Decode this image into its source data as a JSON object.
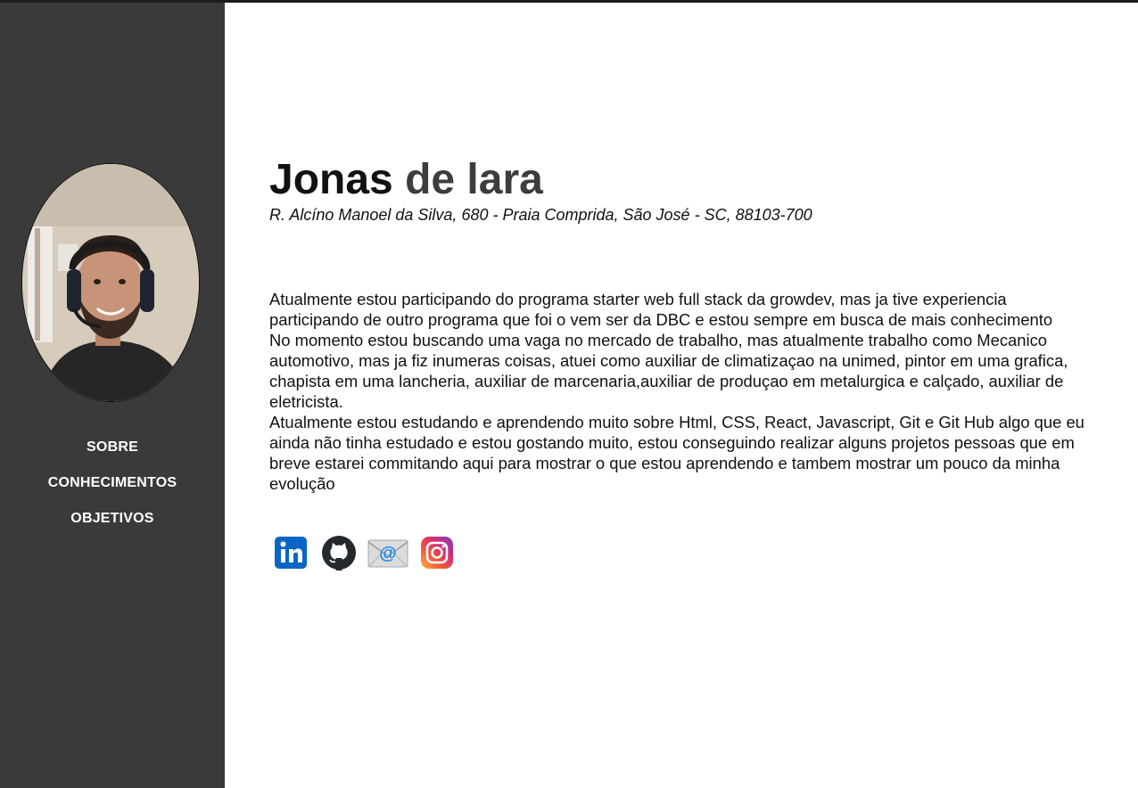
{
  "profile": {
    "first_name": "Jonas",
    "last_name": "de lara",
    "address": "R. Alcíno Manoel da Silva, 680 - Praia Comprida, São José - SC, 88103-700",
    "photo": "profile-photo"
  },
  "nav": {
    "items": [
      {
        "label": "SOBRE"
      },
      {
        "label": "CONHECIMENTOS"
      },
      {
        "label": "OBJETIVOS"
      }
    ]
  },
  "bio": {
    "paragraphs": [
      "Atualmente estou participando do programa starter web full stack da growdev, mas ja tive experiencia participando de outro programa que foi o vem ser da DBC e estou sempre em busca de mais conhecimento",
      "No momento estou buscando uma vaga no mercado de trabalho, mas atualmente trabalho como Mecanico automotivo, mas ja fiz inumeras coisas, atuei como auxiliar de climatizaçao na unimed, pintor em uma grafica, chapista em uma lancheria, auxiliar de marcenaria,auxiliar de produçao em metalurgica e calçado, auxiliar de eletricista.",
      "Atualmente estou estudando e aprendendo muito sobre Html, CSS, React, Javascript, Git e Git Hub algo que eu ainda não tinha estudado e estou gostando muito, estou conseguindo realizar alguns projetos pessoas que em breve estarei commitando aqui para mostrar o que estou aprendendo e tambem mostrar um pouco da minha evolução"
    ]
  },
  "social": {
    "links": [
      {
        "icon": "linkedin-icon",
        "color": "#0a66c2"
      },
      {
        "icon": "github-icon",
        "color": "#24292e"
      },
      {
        "icon": "email-icon",
        "color": "#1e88e5"
      },
      {
        "icon": "instagram-icon",
        "color": "#c13584"
      }
    ]
  },
  "colors": {
    "sidebar": "#3a3a3a",
    "nav_text": "#ffffff",
    "name_first": "#111111",
    "name_last": "#3d3d3d"
  }
}
